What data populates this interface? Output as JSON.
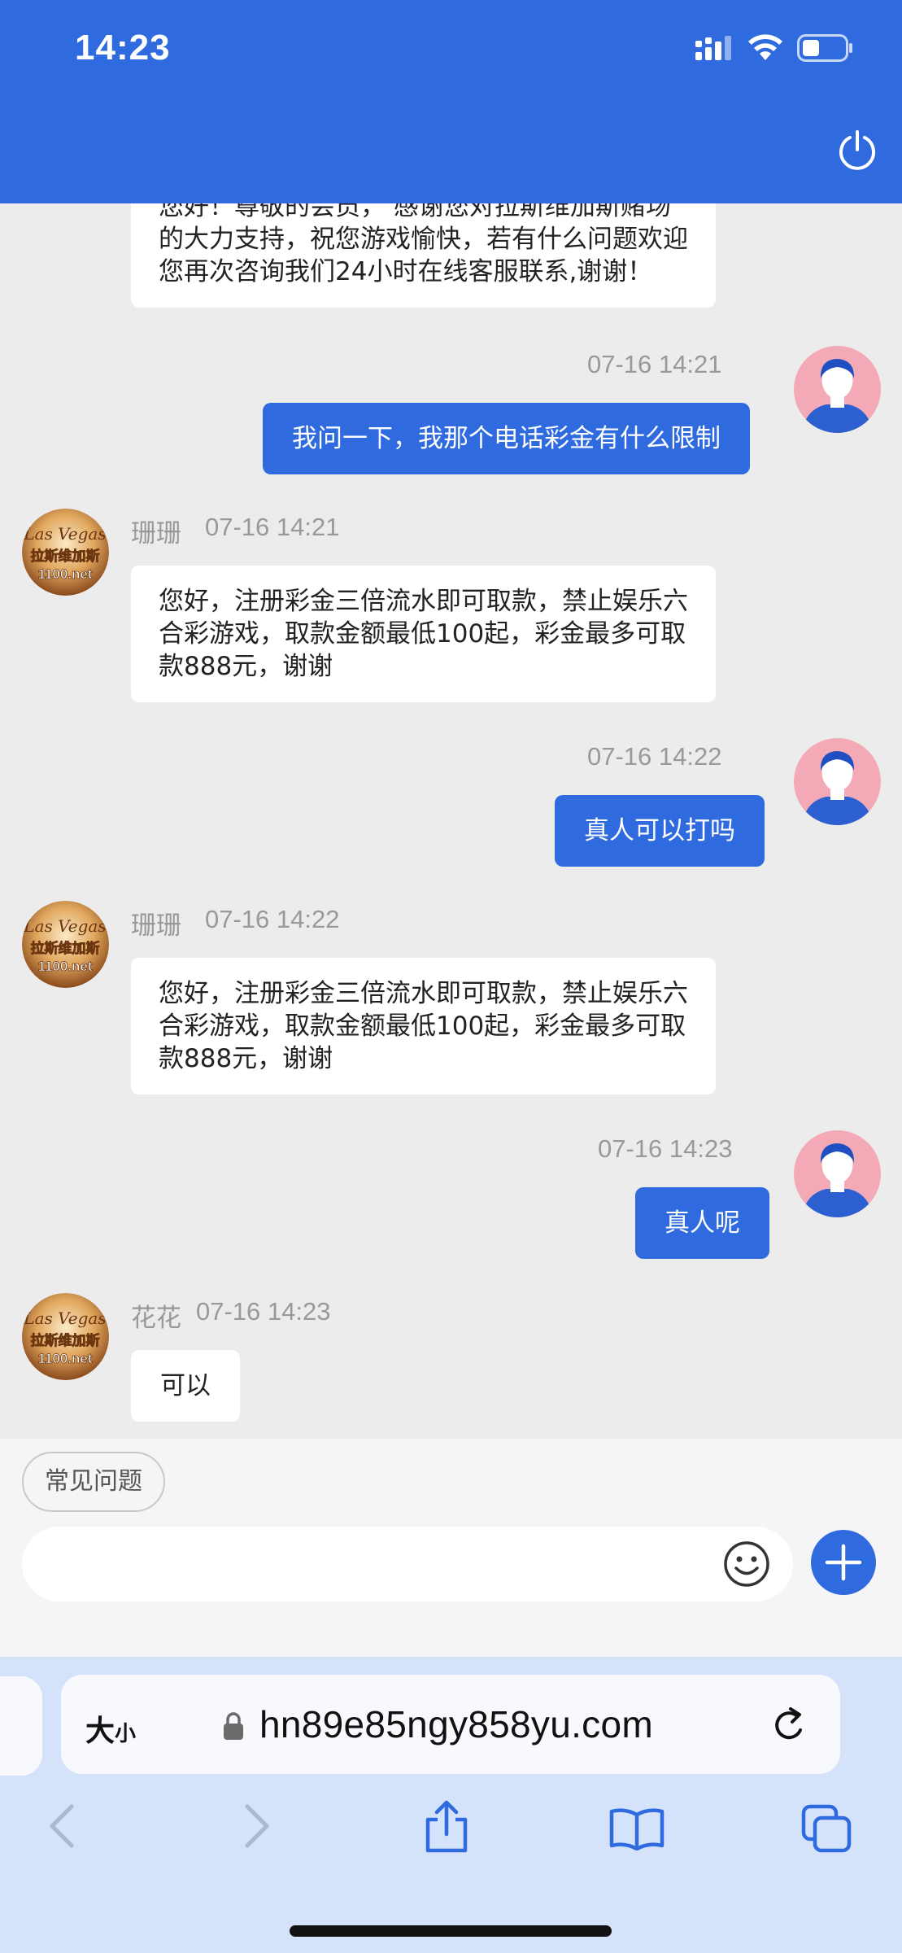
{
  "status": {
    "time": "14:23"
  },
  "messages": [
    {
      "side": "in",
      "text_lines": [
        "您好！尊敬的会员， 感谢您对拉斯维加斯赌场",
        "的大力支持，祝您游戏愉快，若有什么问题欢迎",
        "您再次咨询我们24小时在线客服联系,谢谢！"
      ]
    },
    {
      "side": "out",
      "time": "07-16 14:21",
      "text": "我问一下，我那个电话彩金有什么限制"
    },
    {
      "side": "in",
      "name": "珊珊",
      "time": "07-16 14:21",
      "text_lines": [
        "您好，注册彩金三倍流水即可取款，禁止娱乐六",
        "合彩游戏，取款金额最低100起，彩金最多可取",
        "款888元，谢谢"
      ]
    },
    {
      "side": "out",
      "time": "07-16 14:22",
      "text": "真人可以打吗"
    },
    {
      "side": "in",
      "name": "珊珊",
      "time": "07-16 14:22",
      "text_lines": [
        "您好，注册彩金三倍流水即可取款，禁止娱乐六",
        "合彩游戏，取款金额最低100起，彩金最多可取",
        "款888元，谢谢"
      ]
    },
    {
      "side": "out",
      "time": "07-16 14:23",
      "text": "真人呢"
    },
    {
      "side": "in",
      "name": "花花",
      "time": "07-16 14:23",
      "text_lines": [
        "可以"
      ]
    }
  ],
  "agent_logo": {
    "line1": "Las Vegas",
    "line2": "拉斯维加斯",
    "line3": "1100.net"
  },
  "composer": {
    "faq_label": "常见问题",
    "placeholder": ""
  },
  "browser": {
    "text_size_label": "大",
    "text_size_small": "小",
    "url": "hn89e85ngy858yu.com"
  },
  "colors": {
    "accent": "#2f6bdf",
    "chat_bg": "#ececec",
    "browser_bg": "#d4e2fa"
  }
}
